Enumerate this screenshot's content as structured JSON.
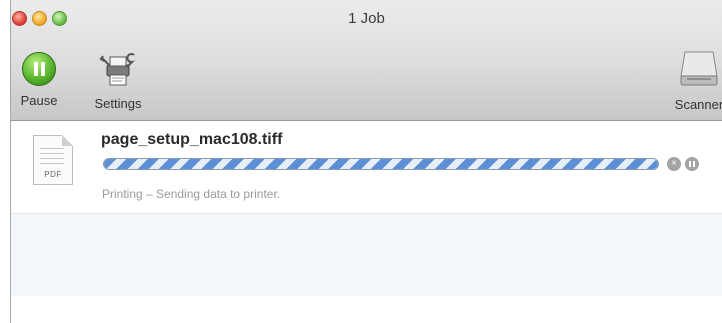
{
  "window": {
    "title": "1 Job"
  },
  "toolbar": {
    "pause_label": "Pause",
    "settings_label": "Settings",
    "scanner_label": "Scanner"
  },
  "job": {
    "name": "page_setup_mac108.tiff",
    "icon_badge": "PDF",
    "status": "Printing – Sending data to printer.",
    "progress": 1.0
  },
  "icons": [
    "close-icon",
    "minimize-icon",
    "zoom-icon",
    "pause-icon",
    "settings-icon",
    "scanner-icon",
    "document-icon",
    "stop-icon",
    "hold-icon"
  ],
  "colors": {
    "accent": "#5d8fd6",
    "pause_green": "#58b52c"
  }
}
